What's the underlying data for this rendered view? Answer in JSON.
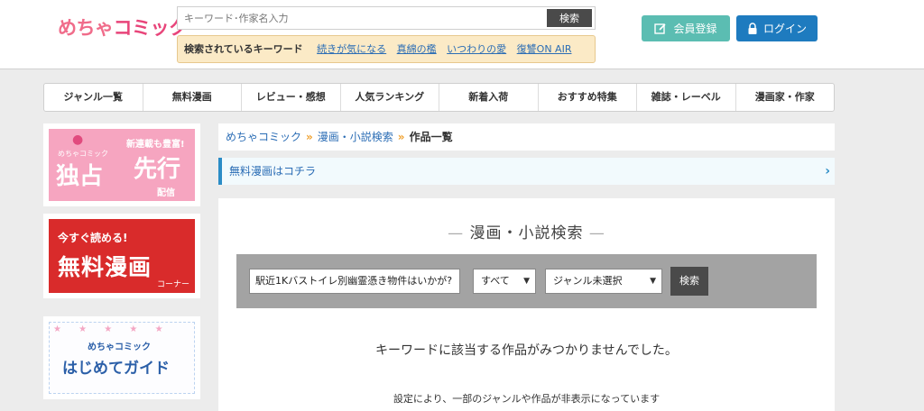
{
  "header": {
    "logo_part1": "めちゃ",
    "logo_part2": "コミック",
    "search_placeholder": "キーワード･作家名入力",
    "search_button": "検索",
    "keywords_label": "検索されているキーワード",
    "keywords": [
      "続きが気になる",
      "真綿の檻",
      "いつわりの愛",
      "復讐ON AIR"
    ],
    "register_label": "会員登録",
    "login_label": "ログイン"
  },
  "nav": {
    "items": [
      "ジャンル一覧",
      "無料漫画",
      "レビュー・感想",
      "人気ランキング",
      "新着入荷",
      "おすすめ特集",
      "雑誌・レーベル",
      "漫画家・作家"
    ]
  },
  "sidebar": {
    "banner1": {
      "sub": "めちゃコミック",
      "small": "新連載も豊富!",
      "left": "独占",
      "right": "先行",
      "tiny": "配信"
    },
    "banner2": {
      "line1": "今すぐ読める!",
      "line2": "無料漫画",
      "line3": "コーナー"
    },
    "banner3": {
      "line1": "めちゃコミック",
      "line2": "はじめてガイド"
    }
  },
  "breadcrumb": {
    "items": [
      "めちゃコミック",
      "漫画・小説検索"
    ],
    "current": "作品一覧"
  },
  "free_link": {
    "label": "無料漫画はコチラ"
  },
  "search": {
    "title": "漫画・小説検索",
    "keyword_value": "駅近1Kバストイレ別幽霊憑き物件はいかが?",
    "category_value": "すべて",
    "genre_value": "ジャンル未選択",
    "button": "検索"
  },
  "results": {
    "no_result": "キーワードに該当する作品がみつかりませんでした。",
    "notice": "設定により、一部のジャンルや作品が非表示になっています"
  },
  "colors": {
    "brand_pink": "#e8457a",
    "register_teal": "#5bbdb2",
    "login_blue": "#1e7bbf",
    "link_blue": "#2b6db5"
  }
}
